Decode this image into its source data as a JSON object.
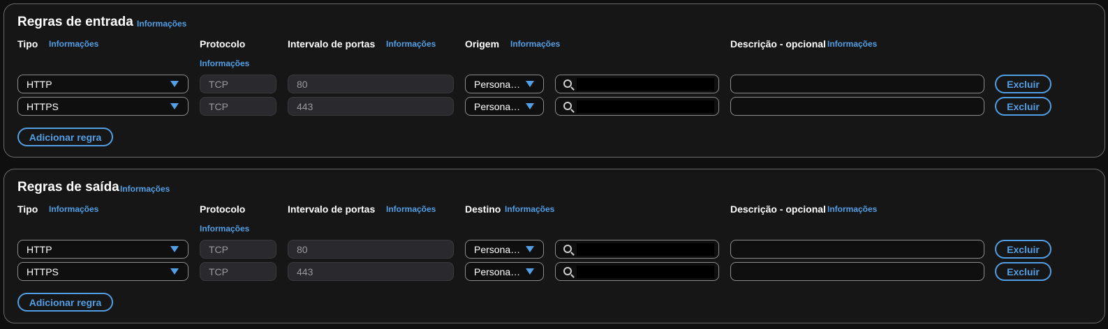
{
  "inbound": {
    "title": "Regras de entrada",
    "info": "Informações",
    "headers": {
      "type": "Tipo",
      "type_info": "Informações",
      "protocol": "Protocolo",
      "protocol_info": "Informações",
      "port_range": "Intervalo de portas",
      "port_info": "Informações",
      "target": "Origem",
      "target_info": "Informações",
      "description": "Descrição - opcional",
      "description_info": "Informações"
    },
    "rows": [
      {
        "type": "HTTP",
        "protocol": "TCP",
        "port": "80",
        "target": "Persona…",
        "description": "",
        "delete": "Excluir"
      },
      {
        "type": "HTTPS",
        "protocol": "TCP",
        "port": "443",
        "target": "Persona…",
        "description": "",
        "delete": "Excluir"
      }
    ],
    "add_rule": "Adicionar regra"
  },
  "outbound": {
    "title": "Regras de saída",
    "info": "Informações",
    "headers": {
      "type": "Tipo",
      "type_info": "Informações",
      "protocol": "Protocolo",
      "protocol_info": "Informações",
      "port_range": "Intervalo de portas",
      "port_info": "Informações",
      "target": "Destino",
      "target_info": "Informações",
      "description": "Descrição - opcional",
      "description_info": "Informações"
    },
    "rows": [
      {
        "type": "HTTP",
        "protocol": "TCP",
        "port": "80",
        "target": "Persona…",
        "description": "",
        "delete": "Excluir"
      },
      {
        "type": "HTTPS",
        "protocol": "TCP",
        "port": "443",
        "target": "Persona…",
        "description": "",
        "delete": "Excluir"
      }
    ],
    "add_rule": "Adicionar regra"
  },
  "colors": {
    "accent": "#539fe5",
    "panel_bg": "#161616",
    "border": "#8d8d8d"
  },
  "icons": {
    "dropdown": "caret-down-icon",
    "search": "search-icon"
  }
}
